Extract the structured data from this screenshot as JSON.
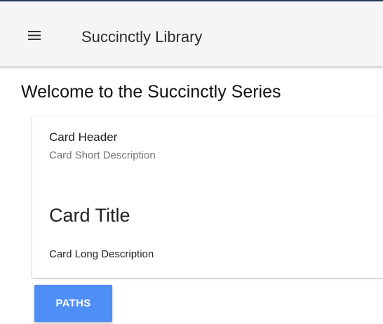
{
  "appbar": {
    "title": "Succinctly Library",
    "menu_icon": "hamburger-menu-icon"
  },
  "main": {
    "heading": "Welcome to the Succinctly Series"
  },
  "card": {
    "header_title": "Card Header",
    "header_subtitle": "Card Short Description",
    "title": "Card Title",
    "text": "Card Long Description",
    "action_label": "PATHS"
  },
  "colors": {
    "appbar_background": "#f5f5f5",
    "top_border": "#1f3a5a",
    "button_accent": "#4f8ef7"
  }
}
